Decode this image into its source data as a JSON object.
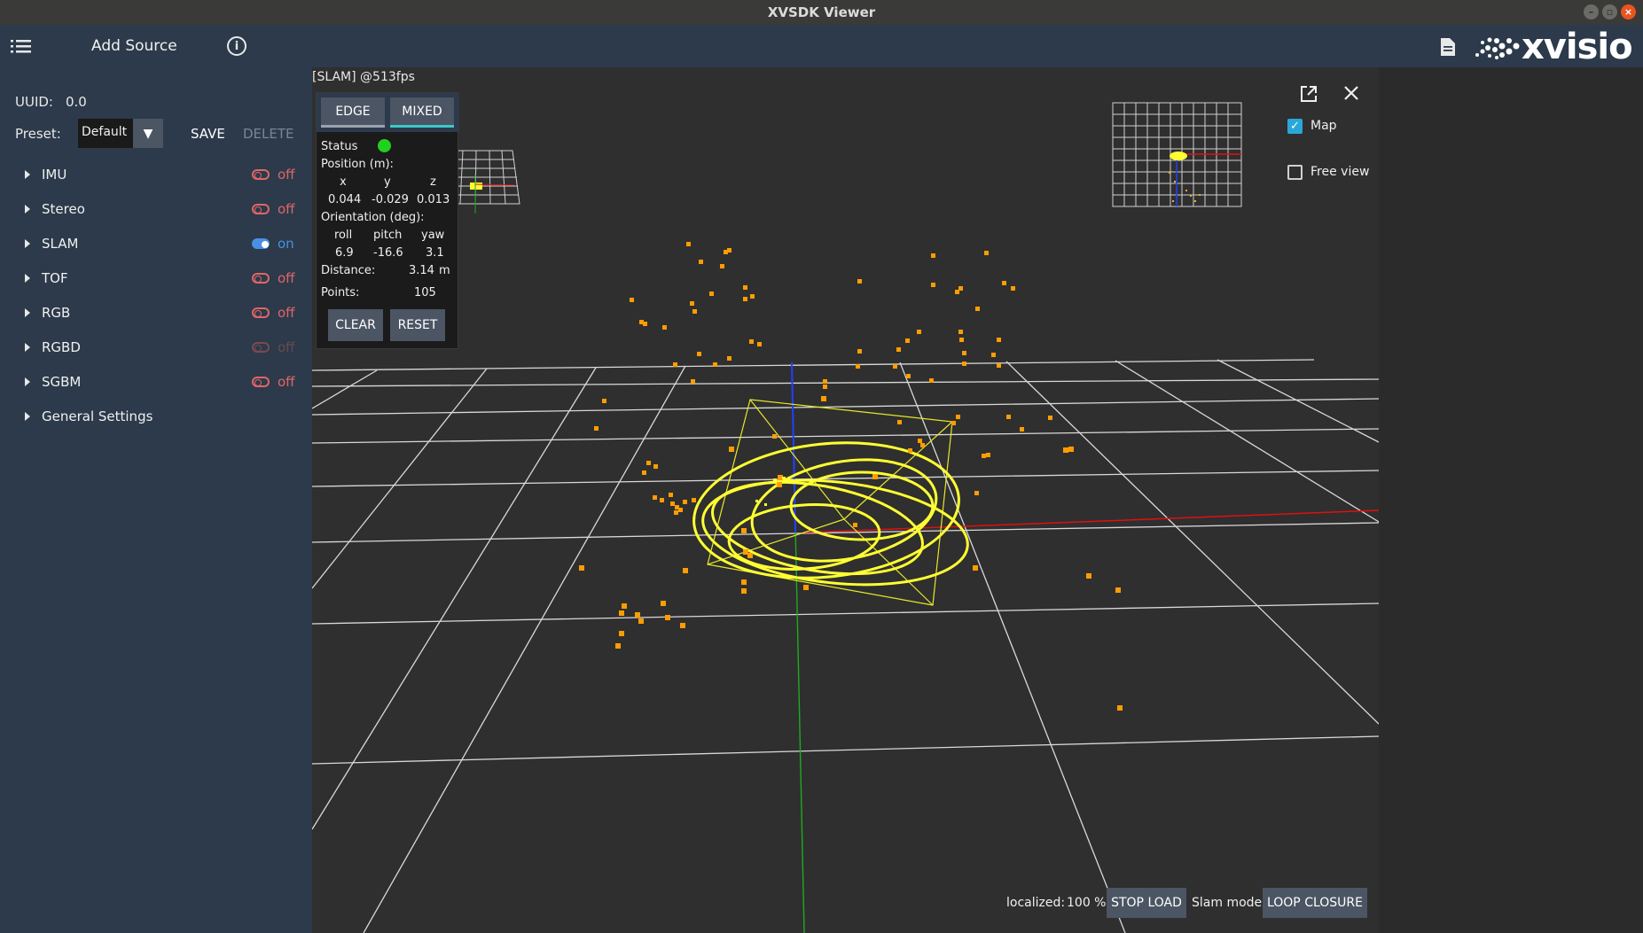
{
  "window": {
    "title": "XVSDK Viewer"
  },
  "topbar": {
    "add_source": "Add Source",
    "logo": "xvisio",
    "info_glyph": "i"
  },
  "sidebar": {
    "uuid_label": "UUID:",
    "uuid_value": "0.0",
    "preset_label": "Preset:",
    "preset_value": "Default",
    "save_label": "SAVE",
    "delete_label": "DELETE",
    "sources": [
      {
        "label": "IMU",
        "state": "off"
      },
      {
        "label": "Stereo",
        "state": "off"
      },
      {
        "label": "SLAM",
        "state": "on"
      },
      {
        "label": "TOF",
        "state": "off"
      },
      {
        "label": "RGB",
        "state": "off"
      },
      {
        "label": "RGBD",
        "state": "off"
      },
      {
        "label": "SGBM",
        "state": "off"
      }
    ],
    "general_settings": "General Settings"
  },
  "viewport": {
    "label": "[SLAM]  @513fps"
  },
  "panel": {
    "tab_edge": "EDGE",
    "tab_mixed": "MIXED",
    "status_label": "Status",
    "status_color": "#1fd21f",
    "position_label": "Position (m):",
    "pos_headers": [
      "x",
      "y",
      "z"
    ],
    "pos_values": [
      "0.044",
      "-0.029",
      "0.013"
    ],
    "orientation_label": "Orientation (deg):",
    "ori_headers": [
      "roll",
      "pitch",
      "yaw"
    ],
    "ori_values": [
      "6.9",
      "-16.6",
      "3.1"
    ],
    "distance_label": "Distance:",
    "distance_value": "3.14",
    "distance_unit": "m",
    "points_label": "Points:",
    "points_value": "105",
    "clear_label": "CLEAR",
    "reset_label": "RESET"
  },
  "view_options": {
    "map_label": "Map",
    "map_checked": true,
    "free_view_label": "Free view",
    "free_view_checked": false
  },
  "bottom": {
    "localized_label": "localized:",
    "localized_value": "100 %",
    "stop_load": "STOP LOAD",
    "slam_mode": "Slam mode",
    "loop_closure": "LOOP CLOSURE"
  },
  "colors": {
    "sidebar_bg": "#2c3a4b",
    "toggle_off": "#e06666",
    "toggle_on": "#4a90e2",
    "points": "#ff9d00",
    "trajectory": "#ffff33"
  }
}
